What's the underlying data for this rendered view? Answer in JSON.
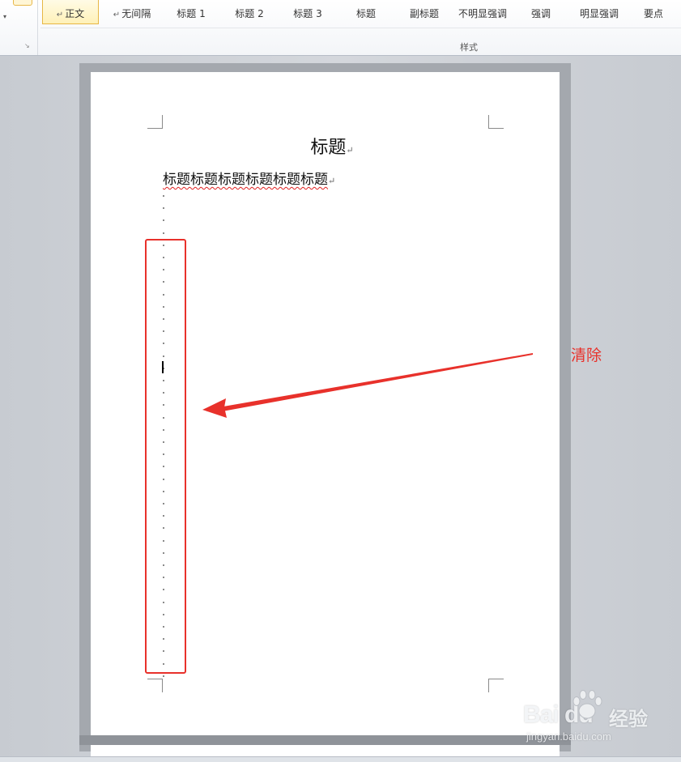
{
  "ribbon": {
    "styles": [
      {
        "label": "正文",
        "mark": "↵",
        "selected": true
      },
      {
        "label": "无间隔",
        "mark": "↵",
        "selected": false
      },
      {
        "label": "标题 1",
        "mark": "",
        "selected": false
      },
      {
        "label": "标题 2",
        "mark": "",
        "selected": false
      },
      {
        "label": "标题 3",
        "mark": "",
        "selected": false
      },
      {
        "label": "标题",
        "mark": "",
        "selected": false
      },
      {
        "label": "副标题",
        "mark": "",
        "selected": false
      },
      {
        "label": "不明显强调",
        "mark": "",
        "selected": false
      },
      {
        "label": "强调",
        "mark": "",
        "selected": false
      },
      {
        "label": "明显强调",
        "mark": "",
        "selected": false
      },
      {
        "label": "要点",
        "mark": "",
        "selected": false
      }
    ],
    "group_label": "样式",
    "more_arrow": "▾",
    "launcher": "↘"
  },
  "document": {
    "title": "标题",
    "body_line": "标题标题标题标题标题标题",
    "paragraph_mark": "↵",
    "empty_paragraph_count": 40
  },
  "annotation": {
    "label": "清除",
    "color": "#e8312b"
  },
  "watermark": {
    "logo": "Bai   du",
    "brand": "经验",
    "url": "jingyan.baidu.com"
  }
}
